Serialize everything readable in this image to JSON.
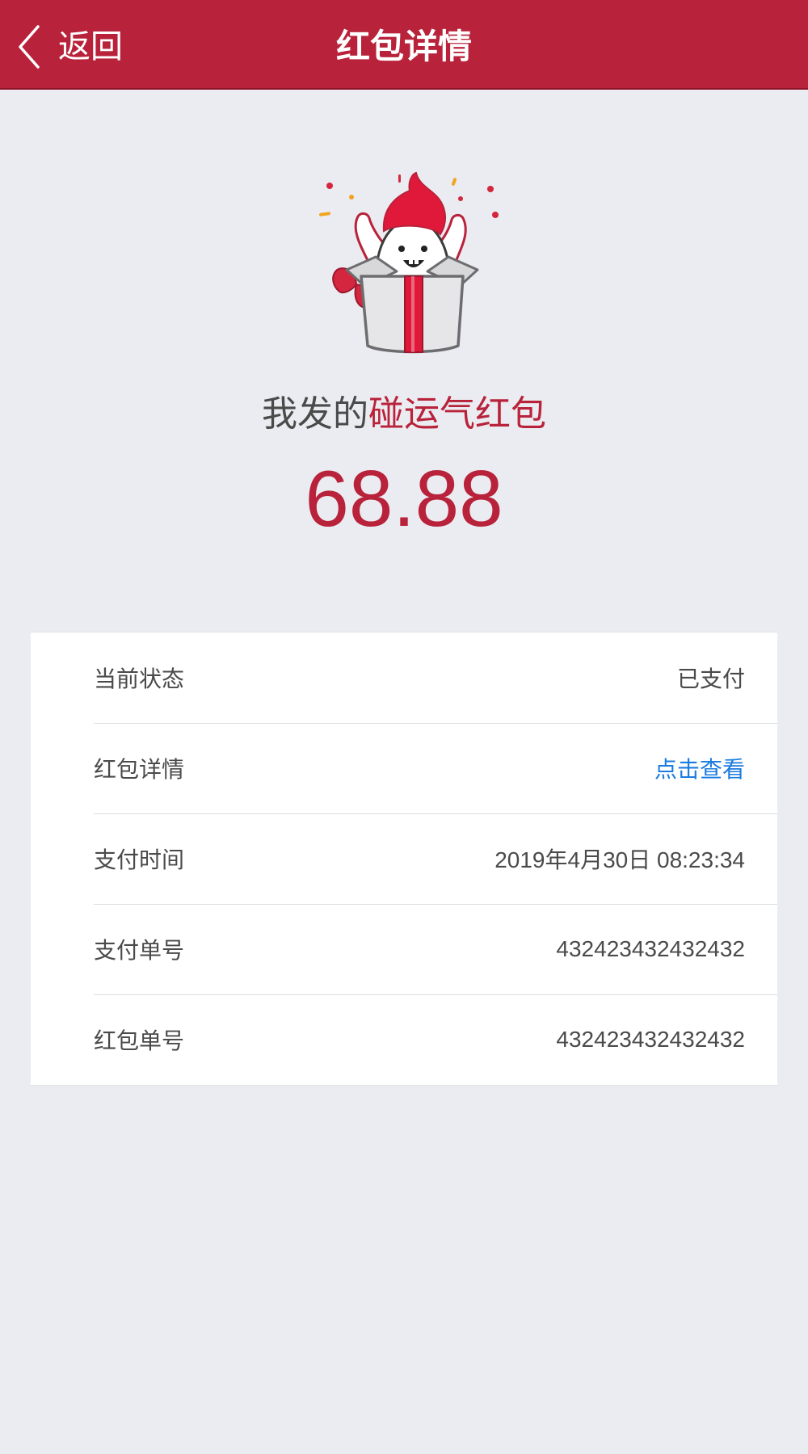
{
  "navbar": {
    "back_label": "返回",
    "title": "红包详情",
    "back_icon": "chevron-left-icon",
    "background": "#b8223a"
  },
  "hero": {
    "illustration": "gift-box-mascot-illustration",
    "headline_prefix": "我发的",
    "headline_type": "碰运气红包",
    "amount": "68.88",
    "accent_color": "#b8223a"
  },
  "details": {
    "rows": [
      {
        "label": "当前状态",
        "value": "已支付"
      },
      {
        "label": "红包详情",
        "value": "点击查看",
        "link_color": "#1a7be0"
      },
      {
        "label": "支付时间",
        "value": "2019年4月30日 08:23:34"
      },
      {
        "label": "支付单号",
        "value": "432423432432432"
      },
      {
        "label": "红包单号",
        "value": "432423432432432"
      }
    ]
  }
}
